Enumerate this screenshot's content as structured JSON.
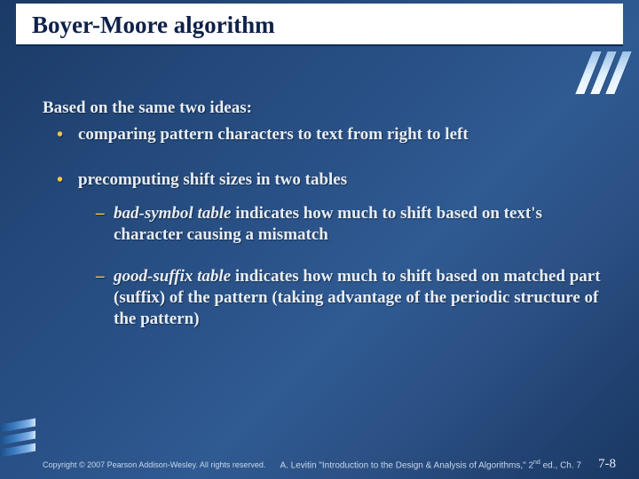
{
  "title": "Boyer-Moore algorithm",
  "intro": "Based on the same two ideas:",
  "bullets": {
    "b1": "comparing pattern characters to text from right to left",
    "b2": "precomputing shift sizes in two tables"
  },
  "subs": {
    "s1_emph": "bad-symbol table",
    "s1_rest": " indicates how much to shift based on text's character causing a mismatch",
    "s2_emph": "good-suffix table",
    "s2_rest": " indicates how much to shift based on matched part (suffix) of the pattern (taking advantage of the periodic structure of the pattern)"
  },
  "footer": {
    "copyright": "Copyright © 2007 Pearson Addison-Wesley. All rights reserved.",
    "center_pre": "A. Levitin \"Introduction to the Design & Analysis of Algorithms,\" 2",
    "center_sup": "nd",
    "center_post": " ed., Ch. 7",
    "page": "7-8"
  }
}
